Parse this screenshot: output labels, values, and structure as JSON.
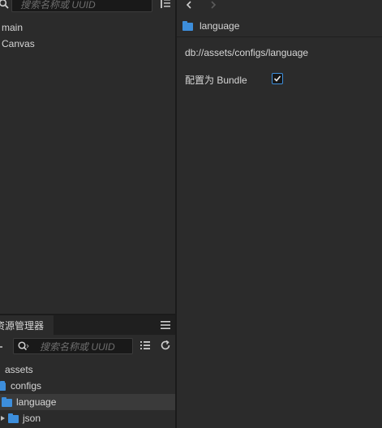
{
  "hierarchy": {
    "search_placeholder": "搜索名称或 UUID",
    "nodes": [
      {
        "label": "main"
      },
      {
        "label": "Canvas"
      }
    ]
  },
  "inspector": {
    "title": "language",
    "path": "db://assets/configs/language",
    "bundle_label": "配置为 Bundle",
    "bundle_checked": true
  },
  "assets": {
    "tab_label": "资源管理器",
    "search_placeholder": "搜索名称或 UUID",
    "tree": [
      {
        "label": "assets"
      },
      {
        "label": "configs"
      },
      {
        "label": "language",
        "selected": true
      },
      {
        "label": "json"
      }
    ]
  },
  "colors": {
    "accent": "#3d8edb",
    "panel_bg": "#2b2b2b",
    "selected_row": "#3a3a3a"
  }
}
